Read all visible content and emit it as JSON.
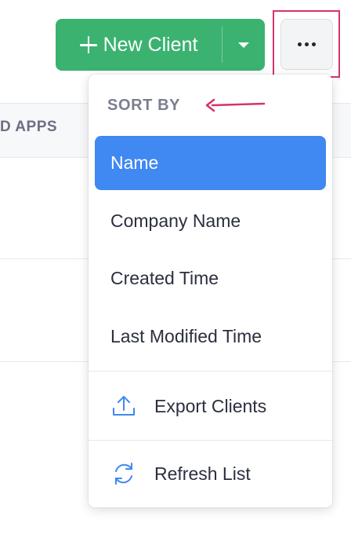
{
  "toolbar": {
    "new_client_label": "New Client",
    "accent_color": "#3bb270"
  },
  "table": {
    "partial_column_header": "D APPS"
  },
  "menu": {
    "sort_by_heading": "SORT BY",
    "sort_options": [
      {
        "label": "Name",
        "selected": true
      },
      {
        "label": "Company Name",
        "selected": false
      },
      {
        "label": "Created Time",
        "selected": false
      },
      {
        "label": "Last Modified Time",
        "selected": false
      }
    ],
    "actions": [
      {
        "label": "Export Clients",
        "icon": "upload-icon"
      },
      {
        "label": "Refresh List",
        "icon": "refresh-icon"
      }
    ],
    "selected_color": "#4088f2"
  },
  "annotation": {
    "highlight_color": "#d6336c"
  }
}
